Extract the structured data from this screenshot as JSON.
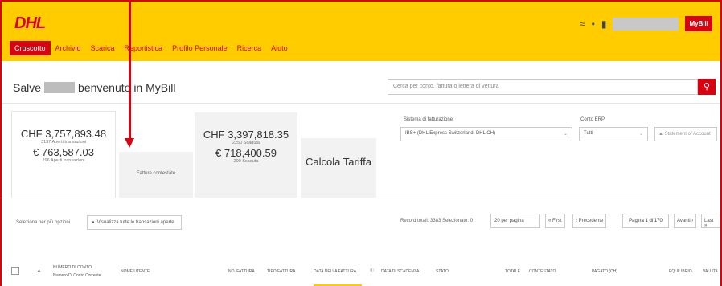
{
  "header": {
    "logo": "DHL",
    "icon1": "≈",
    "icon2": "👤",
    "mybill": "MyBill"
  },
  "nav": [
    "Cruscotto",
    "Archivio",
    "Scarica",
    "Reportistica",
    "Profilo Personale",
    "Ricerca",
    "Aiuto"
  ],
  "welcome": {
    "prefix": "Salve",
    "suffix": "benvenuto in MyBill"
  },
  "search": {
    "placeholder": "Cerca per conto, fattura o lettera di vettura",
    "icon": "search-icon"
  },
  "cards": {
    "open": {
      "amount1": "CHF 3,757,893.48",
      "sub1": "3137 Aperti transazioni",
      "amount2": "€ 763,587.03",
      "sub2": "296 Aperti transazioni"
    },
    "disputed": {
      "label": "Fatture contestate"
    },
    "overdue": {
      "amount1": "CHF 3,397,818.35",
      "sub1": "2250 Scaduta",
      "amount2": "€ 718,400.59",
      "sub2": "200 Scaduta"
    },
    "rate": {
      "label": "Calcola Tariffa"
    }
  },
  "billing": {
    "system_label": "Sistema di fatturazione",
    "system_value": "IBS+ (DHL Express Switzerland, DHL CH)",
    "erp_label": "Conto ERP",
    "erp_value": "Tutti",
    "statement": "Statement of Account"
  },
  "toolbar": {
    "multi": "Seleziona per più opzioni",
    "view_all": "Visualizza tutte le transazioni aperte",
    "records": "Record totali: 3383   Selezionato: 0",
    "perpage": "20 per pagina",
    "first": "« First",
    "prev": "‹ Precedente",
    "pageinfo": "Pagina 1 di 170",
    "next": "Avanti ›",
    "last": "Last »"
  },
  "table": {
    "headers": [
      "Numero di conto",
      "Nome utente",
      "No. fattura",
      "Tipo fattura",
      "Data della fattura",
      "Data di scadenza",
      "Stato",
      "Totale",
      "Contestato",
      "Pagato (CH)",
      "Equilibrio",
      "Valuta"
    ],
    "subheader": "Numero Di Conto Corrente"
  }
}
